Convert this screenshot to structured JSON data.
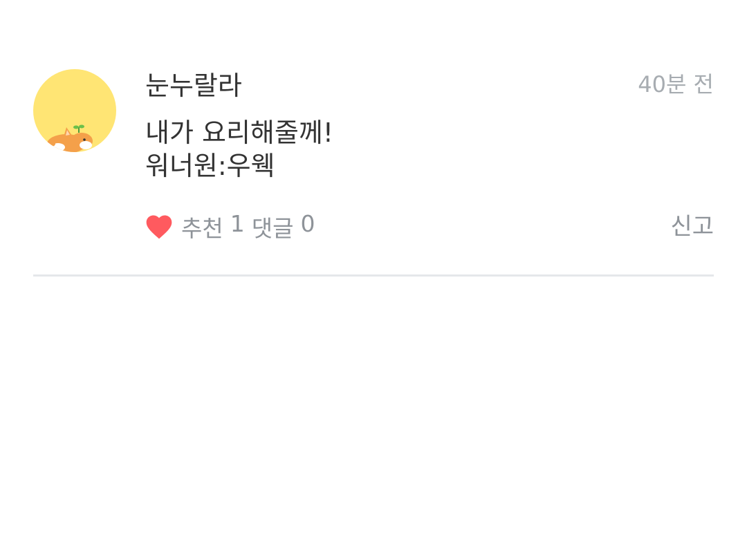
{
  "comment": {
    "author": "눈누랄라",
    "timestamp": "40분 전",
    "text_lines": [
      "내가 요리해줄께!",
      "워너원:우웩"
    ],
    "recommend_label": "추천",
    "recommend_count": "1",
    "reply_label": "댓글",
    "reply_count": "0",
    "report_label": "신고"
  },
  "icons": {
    "avatar": "corgi-avatar-icon",
    "recommend": "heart-icon"
  },
  "colors": {
    "avatar_bg": "#FFE574",
    "heart": "#FF5A5F",
    "text": "#333333",
    "muted": "#8E9399",
    "timestamp": "#A7ACB1",
    "divider": "#E5E7EA"
  }
}
